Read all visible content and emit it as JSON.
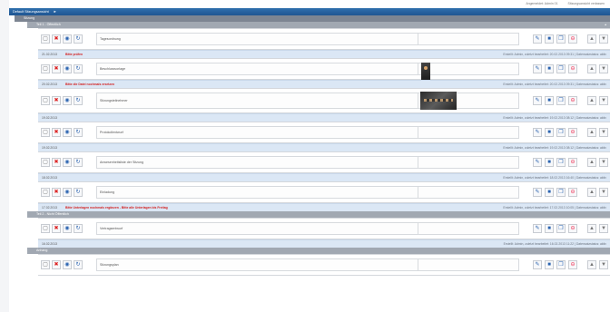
{
  "header": {
    "title": "Default Sitzungsansicht",
    "top_meta": [
      "Angemeldet: Admin 01",
      "Sitzungsansicht verlassen"
    ]
  },
  "sections": [
    {
      "label": "Sitzung"
    },
    {
      "label": "Teil 1 - Öffentlich"
    },
    {
      "label": "Teil 2 - Nicht Öffentlich"
    },
    {
      "label": "Anhang"
    }
  ],
  "items": [
    {
      "name": "Tagesordnung",
      "date": "21.02.2013",
      "warning": "Bitte prüfen",
      "meta": "Erstellt: Admin, zuletzt bearbeitet: 20.02.2013 09:31 | Datensatzstatus: aktiv"
    },
    {
      "name": "Beschlussvorlage",
      "date": "20.02.2013",
      "warning": "Bitte die Datei nochmals ersetzen",
      "meta": "Erstellt: Admin, zuletzt bearbeitet: 20.02.2013 09:31 | Datensatzstatus: aktiv"
    },
    {
      "name": "Sitzungsteilnehmer",
      "date": "19.02.2013",
      "warning": "",
      "meta": "Erstellt: Admin, zuletzt bearbeitet: 19.02.2013 08:12 | Datensatzstatus: aktiv"
    },
    {
      "name": "Protokollentwurf",
      "date": "19.02.2013",
      "warning": "",
      "meta": "Erstellt: Admin, zuletzt bearbeitet: 19.02.2013 08:12 | Datensatzstatus: aktiv"
    },
    {
      "name": "Anwesenheitsliste der Sitzung",
      "date": "18.02.2013",
      "warning": "",
      "meta": "Erstellt: Admin, zuletzt bearbeitet: 18.02.2013 16:40 | Datensatzstatus: aktiv"
    },
    {
      "name": "Einladung",
      "date": "17.02.2013",
      "warning": "Bitte Unterlagen nochmals ergänzen - Bitte alle Unterlagen bis Freitag",
      "meta": "Erstellt: Admin, zuletzt bearbeitet: 17.02.2013 10:05 | Datensatzstatus: aktiv"
    },
    {
      "name": "Vertragsentwurf",
      "date": "16.02.2013",
      "warning": "",
      "meta": "Erstellt: Admin, zuletzt bearbeitet: 16.02.2013 11:22 | Datensatzstatus: aktiv"
    },
    {
      "name": "Sitzungsplan",
      "date": "",
      "warning": "",
      "meta": ""
    }
  ],
  "icons": {
    "select": "checkbox-icon",
    "delete": "delete-icon",
    "view": "view-icon",
    "refresh": "refresh-icon",
    "edit": "edit-icon",
    "save": "save-icon",
    "copy": "copy-icon",
    "remove": "remove-icon",
    "up": "move-up-icon",
    "down": "move-down-icon"
  },
  "colors": {
    "titlebar": "#1f5592",
    "section_l1": "#7d8592",
    "section_l2": "#a1a8b2",
    "info_band": "#dbe7f5",
    "warning": "#d21f1f"
  }
}
